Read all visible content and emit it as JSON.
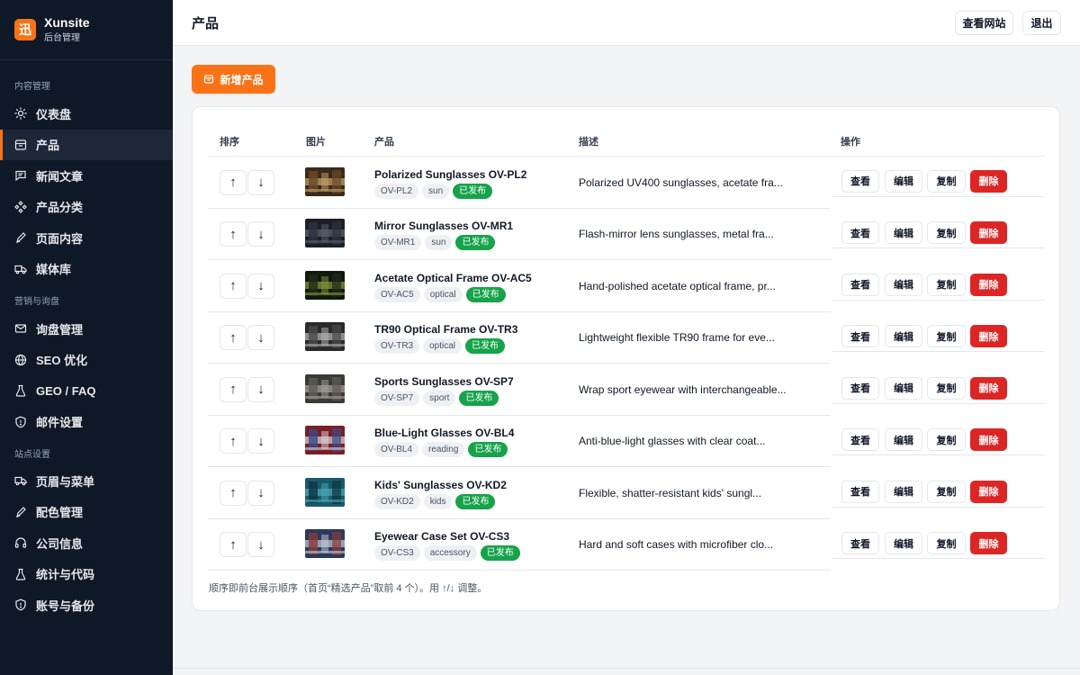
{
  "brand": {
    "logo_char": "迅",
    "name": "Xunsite",
    "subtitle": "后台管理",
    "accent": "#f97316"
  },
  "sidebar": {
    "sections": [
      {
        "label": "内容管理",
        "items": [
          {
            "label": "仪表盘",
            "icon": "sun-icon",
            "active": false
          },
          {
            "label": "产品",
            "icon": "box-icon",
            "active": true
          },
          {
            "label": "新闻文章",
            "icon": "chat-icon",
            "active": false
          },
          {
            "label": "产品分类",
            "icon": "diamond-grid-icon",
            "active": false
          },
          {
            "label": "页面内容",
            "icon": "pen-icon",
            "active": false
          },
          {
            "label": "媒体库",
            "icon": "truck-icon",
            "active": false
          }
        ]
      },
      {
        "label": "营销与询盘",
        "items": [
          {
            "label": "询盘管理",
            "icon": "mail-icon",
            "active": false
          },
          {
            "label": "SEO 优化",
            "icon": "globe-icon",
            "active": false
          },
          {
            "label": "GEO / FAQ",
            "icon": "flask-icon",
            "active": false
          },
          {
            "label": "邮件设置",
            "icon": "shield-icon",
            "active": false
          }
        ]
      },
      {
        "label": "站点设置",
        "items": [
          {
            "label": "页眉与菜单",
            "icon": "truck-icon",
            "active": false
          },
          {
            "label": "配色管理",
            "icon": "pen-icon",
            "active": false
          },
          {
            "label": "公司信息",
            "icon": "headphones-icon",
            "active": false
          },
          {
            "label": "统计与代码",
            "icon": "flask-icon",
            "active": false
          },
          {
            "label": "账号与备份",
            "icon": "shield-icon",
            "active": false
          }
        ]
      }
    ]
  },
  "header": {
    "title": "产品",
    "view_site": "查看网站",
    "logout": "退出"
  },
  "toolbar": {
    "add_label": "新增产品"
  },
  "table": {
    "columns": {
      "order": "排序",
      "image": "图片",
      "product": "产品",
      "description": "描述",
      "actions": "操作"
    },
    "up_arrow": "↑",
    "down_arrow": "↓",
    "actions": {
      "view": "查看",
      "edit": "编辑",
      "copy": "复制",
      "delete": "删除"
    },
    "rows": [
      {
        "name": "Polarized Sunglasses OV-PL2",
        "sku": "OV-PL2",
        "category": "sun",
        "status": "已发布",
        "description": "Polarized UV400 sunglasses, acetate fra...",
        "thumb_colors": [
          "#3b2a1a",
          "#c9a36b",
          "#6b4a2b"
        ]
      },
      {
        "name": "Mirror Sunglasses OV-MR1",
        "sku": "OV-MR1",
        "category": "sun",
        "status": "已发布",
        "description": "Flash-mirror lens sunglasses, metal fra...",
        "thumb_colors": [
          "#1c1f26",
          "#5a6170",
          "#2d323c"
        ]
      },
      {
        "name": "Acetate Optical Frame OV-AC5",
        "sku": "OV-AC5",
        "category": "optical",
        "status": "已发布",
        "description": "Hand-polished acetate optical frame, pr...",
        "thumb_colors": [
          "#0f1a0f",
          "#8a9a3a",
          "#1f2b18"
        ]
      },
      {
        "name": "TR90 Optical Frame OV-TR3",
        "sku": "OV-TR3",
        "category": "optical",
        "status": "已发布",
        "description": "Lightweight flexible TR90 frame for eve...",
        "thumb_colors": [
          "#2a2a2a",
          "#b8b8b8",
          "#4a4a4a"
        ]
      },
      {
        "name": "Sports Sunglasses OV-SP7",
        "sku": "OV-SP7",
        "category": "sport",
        "status": "已发布",
        "description": "Wrap sport eyewear with interchangeable...",
        "thumb_colors": [
          "#3a3a36",
          "#a8a49a",
          "#5e5c55"
        ]
      },
      {
        "name": "Blue-Light Glasses OV-BL4",
        "sku": "OV-BL4",
        "category": "reading",
        "status": "已发布",
        "description": "Anti-blue-light glasses with clear coat...",
        "thumb_colors": [
          "#7a1f22",
          "#d8d8e0",
          "#3a4a8a"
        ]
      },
      {
        "name": "Kids' Sunglasses OV-KD2",
        "sku": "OV-KD2",
        "category": "kids",
        "status": "已发布",
        "description": "Flexible, shatter-resistant kids' sungl...",
        "thumb_colors": [
          "#1a5a6a",
          "#4aa8b8",
          "#0e3440"
        ]
      },
      {
        "name": "Eyewear Case Set OV-CS3",
        "sku": "OV-CS3",
        "category": "accessory",
        "status": "已发布",
        "description": "Hard and soft cases with microfiber clo...",
        "thumb_colors": [
          "#2a3a5a",
          "#c8ccd8",
          "#8a3a3a"
        ]
      }
    ]
  },
  "footnote": "顺序即前台展示顺序（首页“精选产品”取前 4 个）。用 ↑/↓ 调整。"
}
